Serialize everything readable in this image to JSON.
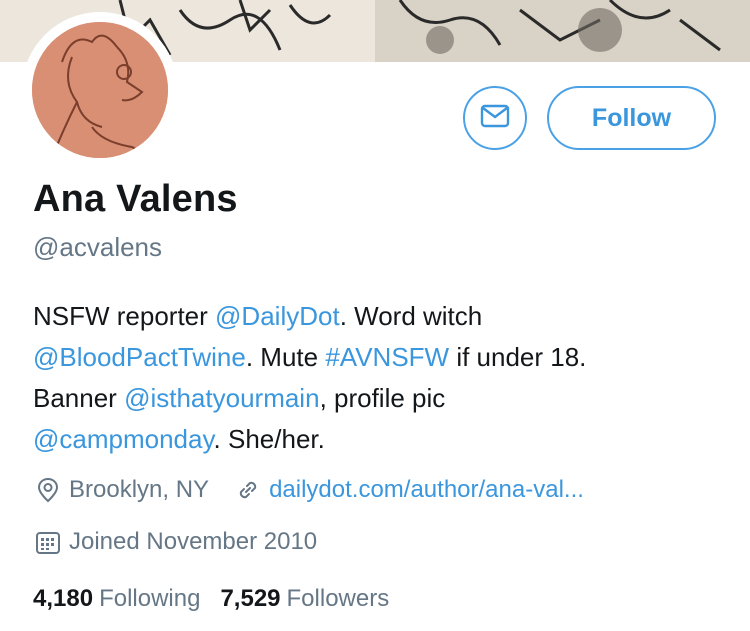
{
  "profile": {
    "name": "Ana Valens",
    "handle": "@acvalens",
    "follow_label": "Follow"
  },
  "bio": {
    "t1": "NSFW reporter ",
    "l1": "@DailyDot",
    "t2": ". Word witch",
    "l2": "@BloodPactTwine",
    "t3": ". Mute ",
    "l3": "#AVNSFW",
    "t4": " if under 18.",
    "t5": "Banner ",
    "l4": "@isthatyourmain",
    "t6": ", profile pic",
    "l5": "@campmonday",
    "t7": ". She/her."
  },
  "meta": {
    "location": "Brooklyn, NY",
    "website": "dailydot.com/author/ana-val...",
    "joined": "Joined November 2010"
  },
  "stats": {
    "following_count": "4,180",
    "following_label": "Following",
    "followers_count": "7,529",
    "followers_label": "Followers"
  },
  "icons": {
    "message": "envelope-icon",
    "location": "location-pin-icon",
    "website": "link-icon",
    "joined": "calendar-icon"
  },
  "colors": {
    "accent": "#3a96dd",
    "secondary_text": "#657786",
    "avatar_bg": "#d98f74"
  }
}
